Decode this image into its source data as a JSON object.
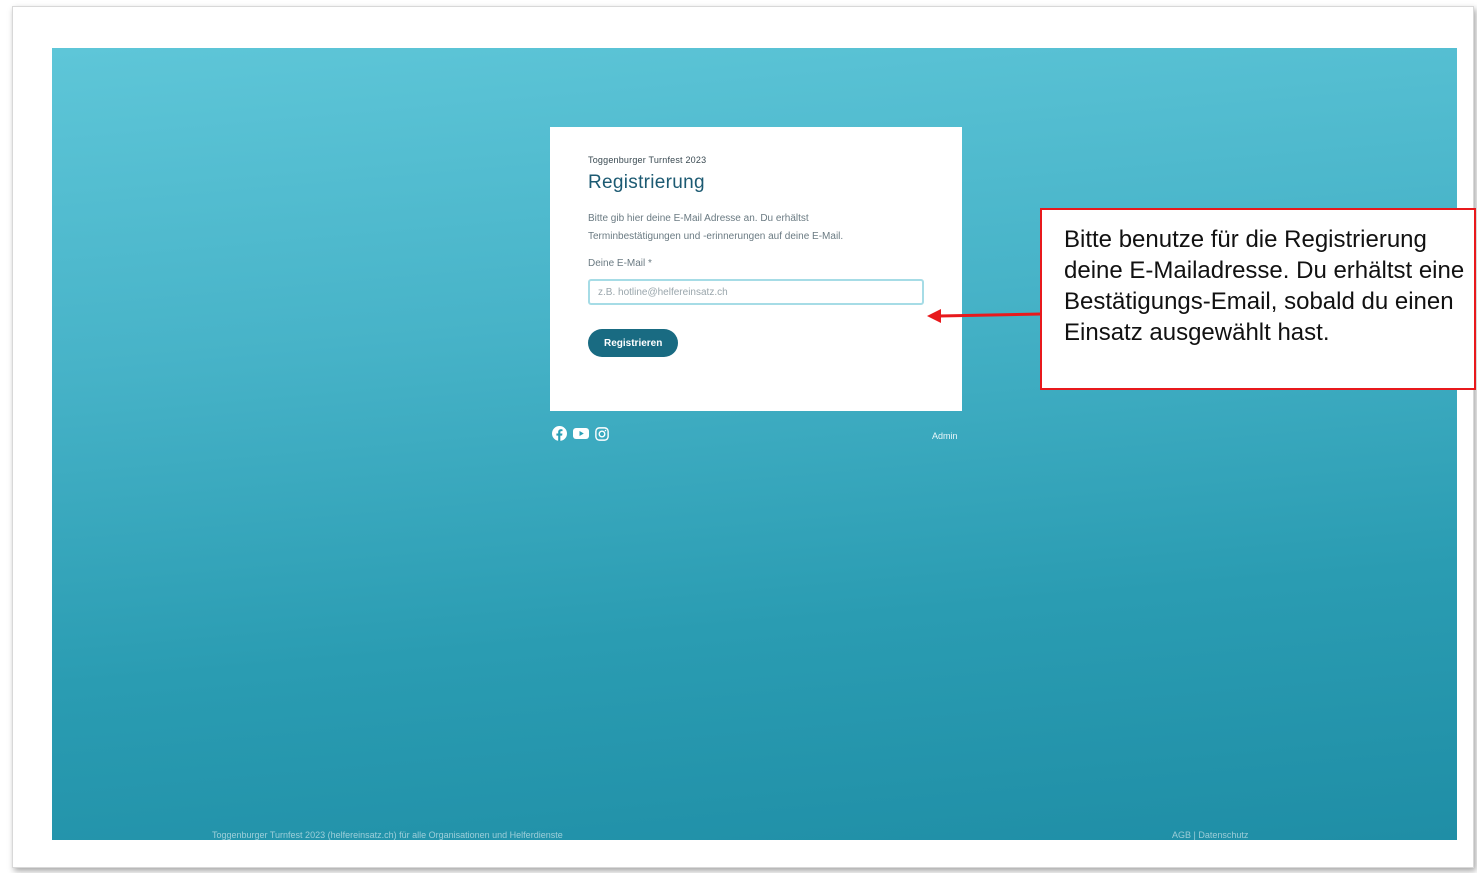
{
  "card": {
    "event_name": "Toggenburger Turnfest 2023",
    "title": "Registrierung",
    "intro": "Bitte gib hier deine E-Mail Adresse an. Du erhältst Terminbestätigungen und -erinnerungen auf deine E-Mail.",
    "email_label": "Deine E-Mail *",
    "email_placeholder": "z.B. hotline@helfereinsatz.ch",
    "register_button": "Registrieren"
  },
  "footer": {
    "admin_link": "Admin",
    "left_text": "Toggenburger Turnfest 2023 (helfereinsatz.ch) für alle Organisationen und Helferdienste",
    "right_text": "AGB | Datenschutz"
  },
  "social_icons": [
    "facebook-icon",
    "youtube-icon",
    "instagram-icon"
  ],
  "callout": {
    "text": "Bitte benutze für die Registrierung deine E-Mailadresse. Du erhältst eine Bestätigungs-Email, sobald du einen Einsatz ausgewählt hast."
  },
  "colors": {
    "background_top": "#5ec6d8",
    "background_bottom": "#1f8ea6",
    "button": "#196b82",
    "title": "#1c5a72",
    "callout_border": "#e8191c"
  }
}
